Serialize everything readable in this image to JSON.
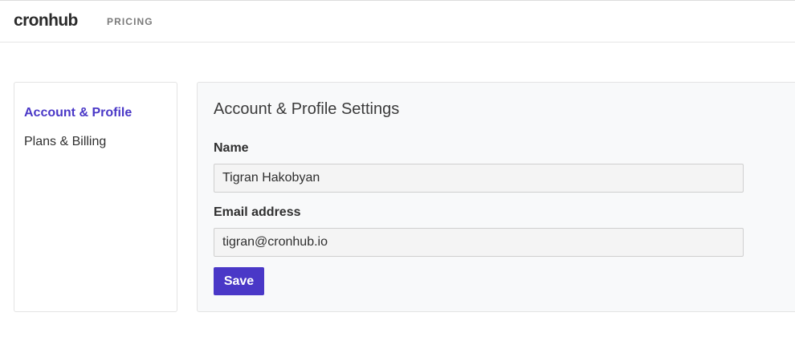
{
  "header": {
    "logo_text": "cronhub",
    "nav": [
      {
        "label": "PRICING"
      }
    ]
  },
  "sidebar": {
    "items": [
      {
        "label": "Account & Profile",
        "active": true
      },
      {
        "label": "Plans & Billing",
        "active": false
      }
    ]
  },
  "settings": {
    "title": "Account & Profile Settings",
    "name_label": "Name",
    "name_value": "Tigran Hakobyan",
    "email_label": "Email address",
    "email_value": "tigran@cronhub.io",
    "save_label": "Save"
  },
  "colors": {
    "accent": "#4a38c7",
    "panel_bg": "#f8f9fa",
    "border": "#e3e3e3"
  }
}
